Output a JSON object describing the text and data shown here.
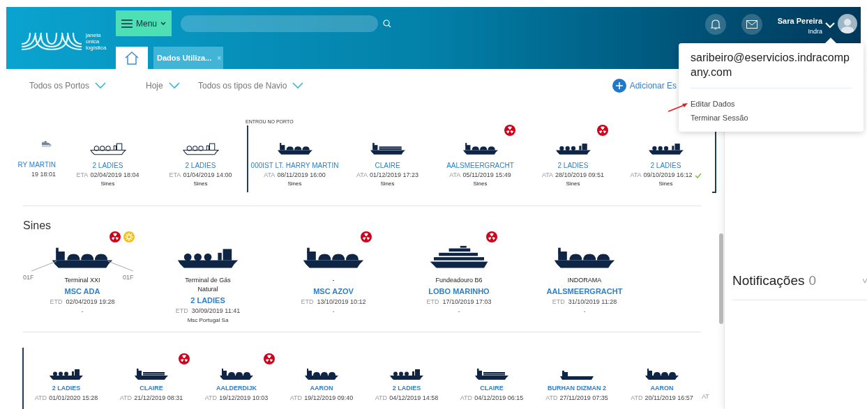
{
  "header": {
    "logo_text": [
      "janela",
      "única",
      "logística"
    ],
    "menu_button": "Menu",
    "tabs": [
      {
        "kind": "home",
        "selected": true
      },
      {
        "kind": "page",
        "label": "Dados Utiliza...",
        "close": "×",
        "selected": false
      }
    ],
    "user": {
      "name": "Sara Pereira",
      "org": "Indra"
    }
  },
  "user_menu": {
    "email": "saribeiro@eservicios.indracompany.com",
    "items": [
      "Editar Dados",
      "Terminar Sessão"
    ]
  },
  "filters": [
    "Todos os Portos",
    "Hoje",
    "Todos os tipos de Navio"
  ],
  "add_button": "Adicionar Es",
  "arrivals": {
    "partial_card": {
      "kind": "ferry",
      "outline": true,
      "name": "RY MARTIN",
      "time": "19 18:01"
    },
    "upcoming_cards": [
      {
        "kind": "lng",
        "outline": true,
        "name": "2 LADIES",
        "prefix": "ETA",
        "time": "02/04/2019 18:04",
        "port": "Sines",
        "checked": false
      },
      {
        "kind": "lng",
        "outline": true,
        "name": "2 LADIES",
        "prefix": "ETA",
        "time": "01/04/2019 14:00",
        "port": "Sines",
        "checked": false
      }
    ],
    "marker": "ENTROU NO PORTO",
    "cards": [
      {
        "kind": "tanker",
        "outline": false,
        "name": "000IST LT. HARRY MARTIN",
        "prefix": "ATA",
        "time": "08/11/2019 16:00",
        "port": "Sines",
        "checked": false
      },
      {
        "kind": "container",
        "outline": false,
        "name": "CLAIRE",
        "prefix": "ATA",
        "time": "01/12/2019 17:23",
        "port": "Sines",
        "checked": false
      },
      {
        "kind": "tanker",
        "outline": false,
        "name": "AALSMEERGRACHT",
        "prefix": "ATA",
        "time": "05/11/2019 15:49",
        "port": "Sines",
        "badges": [
          {
            "kind": "radioactive"
          }
        ],
        "checked": false
      },
      {
        "kind": "lng",
        "outline": false,
        "name": "2 LADIES",
        "prefix": "ATA",
        "time": "28/10/2019 09:51",
        "port": "Sines",
        "badges": [
          {
            "kind": "radioactive"
          }
        ],
        "checked": false
      },
      {
        "kind": "lng",
        "outline": false,
        "name": "2 LADIES",
        "prefix": "ATA",
        "time": "09/10/2019 16:12",
        "port": "Sines",
        "checked": true
      }
    ]
  },
  "port_section": {
    "title": "Sines",
    "cards": [
      {
        "kind": "tanker",
        "berth": "Terminal XXI",
        "berth_left": "01F",
        "berth_right": "01F",
        "name": "MSC ADA",
        "prefix": "ETD",
        "time": "02/04/2019 19:28",
        "agent": "-",
        "badges": [
          {
            "kind": "radioactive"
          },
          {
            "kind": "hazard"
          }
        ]
      },
      {
        "kind": "lng",
        "berth": "Terminal de Gás Natural",
        "name": "2 LADIES",
        "prefix": "ETD",
        "time": "30/09/2019 11:41",
        "agent": "Msc Portugal Sa"
      },
      {
        "kind": "tanker",
        "berth": "-",
        "name": "MSC AZOV",
        "prefix": "ETD",
        "time": "13/10/2019 10:12",
        "agent": "-",
        "badges": [
          {
            "kind": "radioactive"
          }
        ]
      },
      {
        "kind": "ferry",
        "berth": "Fundeadouro B6",
        "name": "LOBO MARINHO",
        "prefix": "ETD",
        "time": "17/10/2019 17:03",
        "agent": "-",
        "badges": [
          {
            "kind": "radioactive"
          }
        ]
      },
      {
        "kind": "tanker",
        "berth": "INDORAMA",
        "name": "AALSMEERGRACHT",
        "prefix": "ETD",
        "time": "31/10/2019 11:28",
        "agent": "-"
      }
    ]
  },
  "departures": {
    "cards": [
      {
        "kind": "lng",
        "name": "2 LADIES",
        "prefix": "ATD",
        "time": "01/01/2020 15:28"
      },
      {
        "kind": "container",
        "name": "CLAIRE",
        "prefix": "ATD",
        "time": "21/12/2019 08:31",
        "badges": [
          {
            "kind": "radioactive"
          }
        ]
      },
      {
        "kind": "tanker",
        "name": "AALDERDIJK",
        "prefix": "ATD",
        "time": "19/12/2019 10:03",
        "badges": [
          {
            "kind": "radioactive"
          }
        ]
      },
      {
        "kind": "tanker",
        "name": "AARON",
        "prefix": "ATD",
        "time": "19/12/2019 09:40"
      },
      {
        "kind": "lng",
        "name": "2 LADIES",
        "prefix": "ATD",
        "time": "04/12/2019 14:58"
      },
      {
        "kind": "container",
        "name": "CLAIRE",
        "prefix": "ATD",
        "time": "04/12/2019 06:15"
      },
      {
        "kind": "cargo",
        "name": "BURHAN DIZMAN 2",
        "prefix": "ATD",
        "time": "27/11/2019 07:35"
      },
      {
        "kind": "tanker",
        "name": "AARON",
        "prefix": "ATD",
        "time": "20/11/2019 16:57"
      }
    ],
    "partial_label": "AT"
  },
  "notifications": {
    "title": "Notificações",
    "count": "0"
  }
}
